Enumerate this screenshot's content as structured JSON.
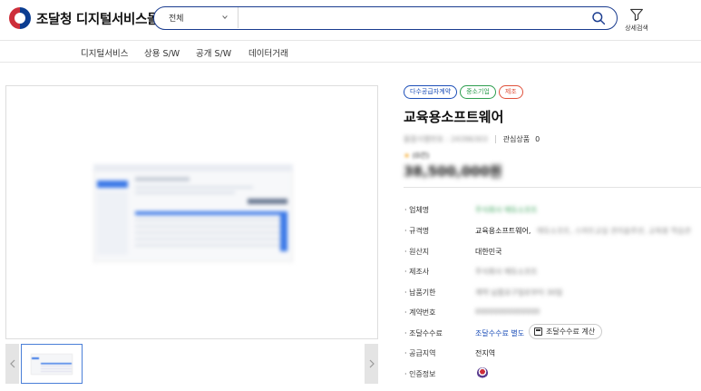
{
  "header": {
    "logo_text": "조달청 디지털서비스몰",
    "search_category": "전체",
    "search_placeholder": "",
    "detail_search_label": "상세검색"
  },
  "nav": {
    "items": [
      "디지털서비스",
      "상용 S/W",
      "공개 S/W",
      "데이터거래"
    ]
  },
  "product": {
    "tags": [
      {
        "label": "다수공급자계약",
        "color": "#1d4fb8"
      },
      {
        "label": "중소기업",
        "color": "#2e9e4f"
      },
      {
        "label": "제조",
        "color": "#e0523c"
      }
    ],
    "title": "교육용소프트웨어",
    "product_code": "물품식별번호 : 24396303",
    "interest_label": "관심상품",
    "interest_count": "0",
    "rating_text": "(0건)",
    "price": "38,500,000원"
  },
  "specs": [
    {
      "label": "· 업체명",
      "value": "주식회사 에듀소프트"
    },
    {
      "label": "· 규격명",
      "value": "교육용소프트웨어,",
      "value_extra": "에듀소프트, 스마트교실 관리솔루션, 교육용 학습관리 프로그램, 온라인 ..."
    },
    {
      "label": "· 원산지",
      "value": "대한민국"
    },
    {
      "label": "· 제조사",
      "value": "주식회사 에듀소프트"
    },
    {
      "label": "· 납품기한",
      "value": "계약 납품요구일로부터 30일"
    },
    {
      "label": "· 계약번호",
      "value": "00000000000000"
    },
    {
      "label": "· 조달수수료",
      "value": "조달수수료 별도",
      "button": "조달수수료 계산"
    },
    {
      "label": "· 공급지역",
      "value": "전지역"
    },
    {
      "label": "· 인증정보",
      "value": ""
    }
  ]
}
